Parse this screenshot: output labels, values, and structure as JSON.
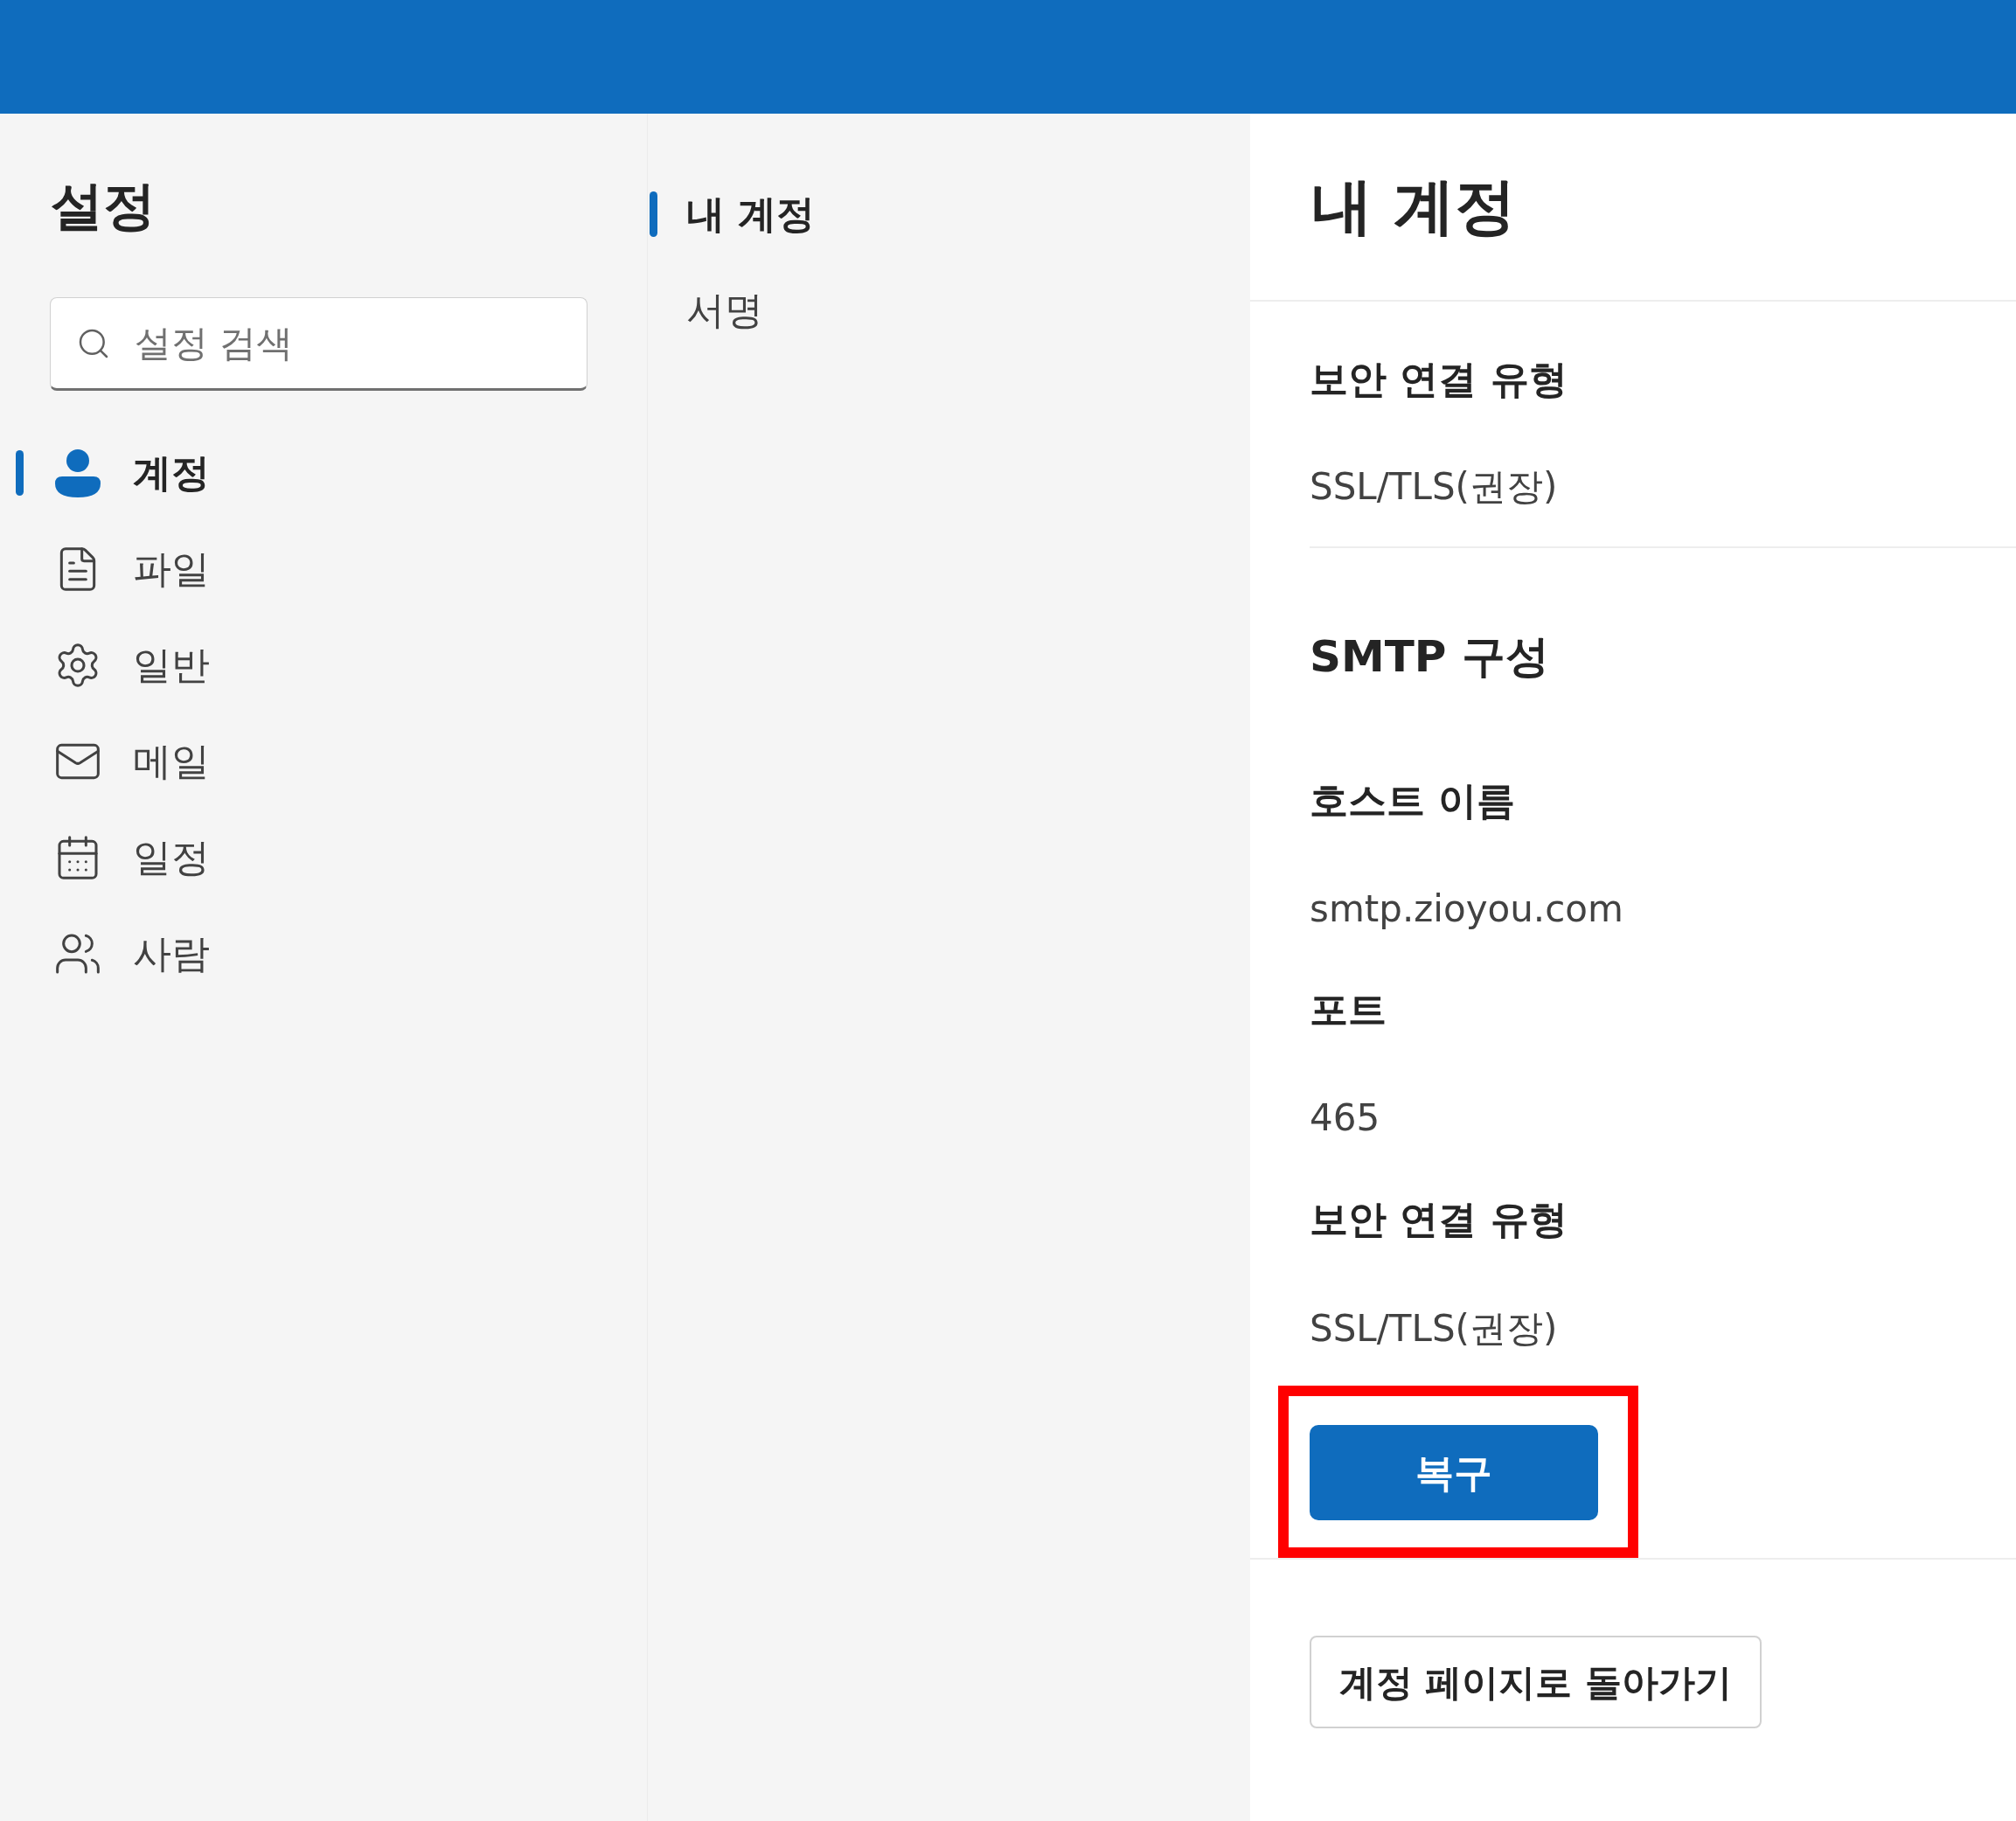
{
  "settings_title": "설정",
  "search": {
    "placeholder": "설정 검색"
  },
  "categories": [
    {
      "label": "계정",
      "selected": true
    },
    {
      "label": "파일",
      "selected": false
    },
    {
      "label": "일반",
      "selected": false
    },
    {
      "label": "메일",
      "selected": false
    },
    {
      "label": "일정",
      "selected": false
    },
    {
      "label": "사람",
      "selected": false
    }
  ],
  "subpages": [
    {
      "label": "내 계정",
      "selected": true
    },
    {
      "label": "서명",
      "selected": false
    }
  ],
  "page": {
    "title": "내 계정",
    "security": {
      "label": "보안 연결 유형",
      "value": "SSL/TLS(권장)"
    },
    "smtp": {
      "heading": "SMTP 구성",
      "fields": [
        {
          "label": "호스트 이름",
          "value": "smtp.zioyou.com"
        },
        {
          "label": "포트",
          "value": "465"
        },
        {
          "label": "보안 연결 유형",
          "value": "SSL/TLS(권장)"
        }
      ],
      "action": {
        "label": "복구",
        "highlighted": true
      }
    },
    "back_button": "계정 페이지로 돌아가기"
  }
}
